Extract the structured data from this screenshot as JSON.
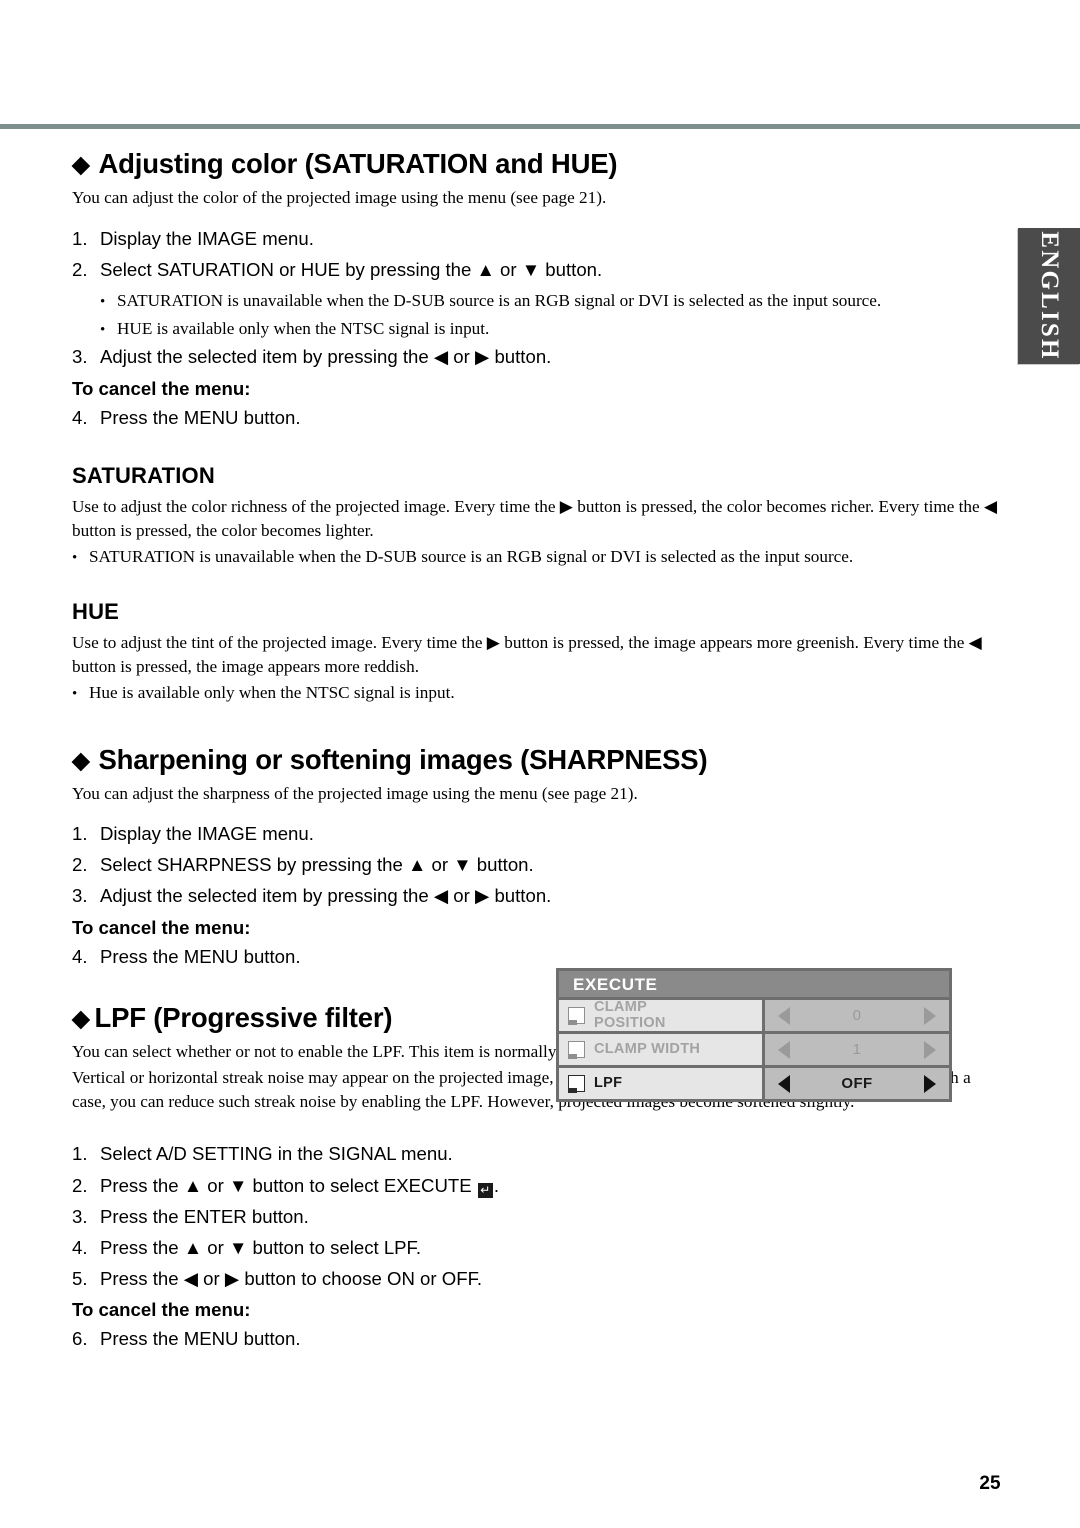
{
  "page": {
    "number": "25",
    "language_tab": "ENGLISH",
    "rule_color": "#7e908e"
  },
  "sections": [
    {
      "id": "saturation_hue",
      "diamond": "◆",
      "title": "Adjusting color (SATURATION and HUE)",
      "intro": "You can adjust the color of the projected image using the menu (see page 21).",
      "steps": [
        {
          "num": "1.",
          "text": "Display the IMAGE menu."
        },
        {
          "num": "2.",
          "text": "Select SATURATION or HUE by pressing the ▲ or ▼ button."
        }
      ],
      "bullets": [
        "SATURATION is unavailable when the D-SUB source is an RGB signal or DVI is selected as the input source.",
        "HUE is available only when the NTSC signal is input."
      ],
      "step3": {
        "num": "3.",
        "text": "Adjust the selected item by pressing the ◀ or ▶ button."
      },
      "cancel_label": "To cancel the menu:",
      "cancel_step": {
        "num": "4.",
        "text": "Press the MENU button."
      }
    },
    {
      "id": "saturation",
      "title": "SATURATION",
      "body": "Use to adjust the color richness of the projected image. Every time the ▶ button is pressed, the color becomes richer. Every time the ◀ button is pressed, the color becomes lighter.",
      "bullets": [
        "SATURATION is unavailable when the D-SUB source is an RGB signal or DVI is selected as the input source."
      ]
    },
    {
      "id": "hue",
      "title": "HUE",
      "body": "Use to adjust the tint of the projected image. Every time the ▶ button is pressed, the image appears more greenish. Every time the ◀ button is pressed, the image appears more reddish.",
      "bullets": [
        "Hue is available only when the NTSC signal is input."
      ]
    },
    {
      "id": "sharpness",
      "diamond": "◆",
      "title": "Sharpening or softening images (SHARPNESS)",
      "intro": "You can adjust the sharpness of the projected image using the menu (see page 21).",
      "steps": [
        {
          "num": "1.",
          "text": "Display the IMAGE menu."
        },
        {
          "num": "2.",
          "text": "Select SHARPNESS by pressing the ▲ or ▼ button."
        },
        {
          "num": "3.",
          "text": "Adjust the selected item by pressing the ◀ or ▶ button."
        }
      ],
      "cancel_label": "To cancel the menu:",
      "cancel_step": {
        "num": "4.",
        "text": "Press the MENU button."
      }
    },
    {
      "id": "lpf",
      "diamond": "◆",
      "title": "LPF (Progressive filter)",
      "intro1": "You can select whether or not to enable the LPF. This item is normally set to OFF.",
      "intro2": "Vertical or horizontal streak noise may appear on the projected image, depending on the type of the DVD player you use. In such a case, you can reduce such streak noise by enabling the LPF. However, projected images become softened slightly.",
      "steps": [
        {
          "num": "1.",
          "text": "Select A/D SETTING in the SIGNAL menu."
        },
        {
          "num": "2.",
          "text_before": "Press the ▲ or ▼ button to select EXECUTE ",
          "glyph": "↵",
          "text_after": "."
        },
        {
          "num": "3.",
          "text": "Press the ENTER button."
        },
        {
          "num": "4.",
          "text": "Press the ▲ or ▼ button to select LPF."
        },
        {
          "num": "5.",
          "text": "Press the ◀ or ▶ button to choose ON or OFF."
        }
      ],
      "cancel_label": "To cancel the menu:",
      "cancel_step": {
        "num": "6.",
        "text": "Press the MENU button."
      }
    }
  ],
  "osd_menu": {
    "title": "EXECUTE",
    "rows": [
      {
        "label_line1": "CLAMP",
        "label_line2": "POSITION",
        "value": "0",
        "enabled": false
      },
      {
        "label_line1": "CLAMP WIDTH",
        "label_line2": "",
        "value": "1",
        "enabled": false
      },
      {
        "label_line1": "LPF",
        "label_line2": "",
        "value": "OFF",
        "enabled": true
      }
    ]
  }
}
